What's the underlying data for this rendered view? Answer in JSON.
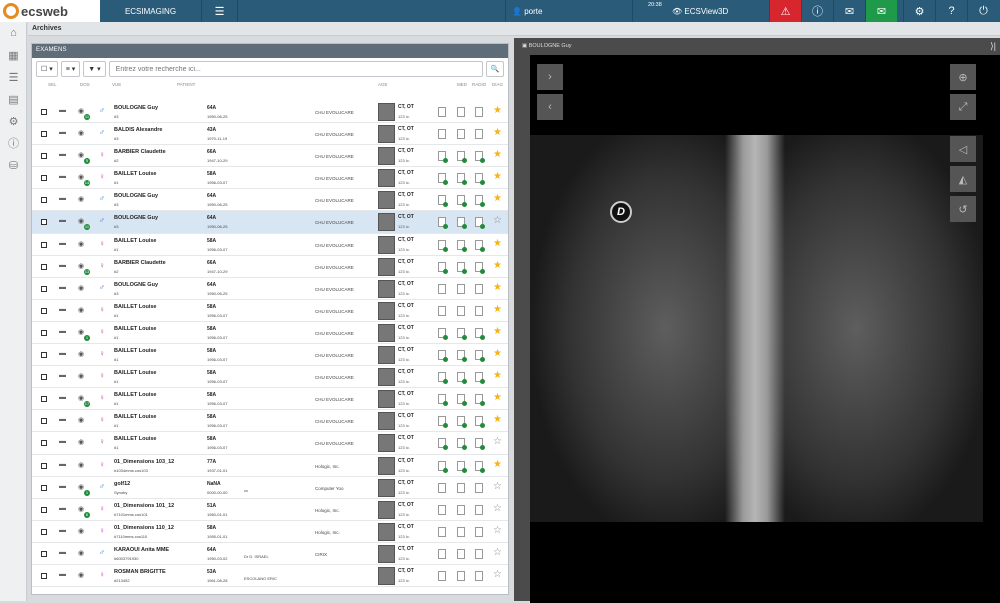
{
  "topbar": {
    "logo_text": "ecsweb",
    "app_name": "ECSIMAGING",
    "menu_icon": "☰",
    "user_name": "porte",
    "time": "20:38",
    "viewer_label": "ECSView3D",
    "alert_color": "#d8262f",
    "mail_color": "#1f9a4a",
    "bar_color": "#2a5b78"
  },
  "breadcrumb": {
    "title": "Archives"
  },
  "panel": {
    "title": "EXAMENS",
    "search_placeholder": "Entrez votre recherche ici...",
    "columns": [
      "SEL",
      "DOS",
      "VUE",
      "PATIENT",
      "AGE",
      "MED",
      "RADIO",
      "DIAG"
    ]
  },
  "rows": [
    {
      "sex": "m",
      "name": "BOULOGNE Guy",
      "sub": "#3",
      "age": "64A",
      "date": "1950-06-25",
      "doc": "",
      "ins": "CHU EVOLUCARE",
      "mod": "CT, OT",
      "imgs": "123 Ic.",
      "badge": "11",
      "star": true,
      "check": false
    },
    {
      "sex": "m",
      "name": "BALDIS Alexandre",
      "sub": "#3",
      "age": "43A",
      "date": "1970-11-19",
      "doc": "",
      "ins": "CHU EVOLUCARE",
      "mod": "CT, OT",
      "imgs": "123 Ic.",
      "badge": "",
      "star": true,
      "check": false
    },
    {
      "sex": "f",
      "name": "BARBIER Claudette",
      "sub": "#2",
      "age": "66A",
      "date": "1947-10-29",
      "doc": "",
      "ins": "CHU EVOLUCARE",
      "mod": "CT, OT",
      "imgs": "123 Ic.",
      "badge": "5",
      "star": true,
      "check": true
    },
    {
      "sex": "f",
      "name": "BAILLET Louise",
      "sub": "#1",
      "age": "58A",
      "date": "1956-03-07",
      "doc": "",
      "ins": "CHU EVOLUCARE",
      "mod": "CT, OT",
      "imgs": "123 Ic.",
      "badge": "14",
      "star": true,
      "check": true
    },
    {
      "sex": "m",
      "name": "BOULOGNE Guy",
      "sub": "#3",
      "age": "64A",
      "date": "1950-06-25",
      "doc": "",
      "ins": "CHU EVOLUCARE",
      "mod": "CT, OT",
      "imgs": "123 Ic.",
      "badge": "",
      "star": true,
      "check": true
    },
    {
      "sex": "m",
      "name": "BOULOGNE Guy",
      "sub": "#3",
      "age": "64A",
      "date": "1950-06-25",
      "doc": "",
      "ins": "CHU EVOLUCARE",
      "mod": "CT, OT",
      "imgs": "123 Ic.",
      "badge": "11",
      "star": false,
      "check": true,
      "sel": true
    },
    {
      "sex": "f",
      "name": "BAILLET Louise",
      "sub": "#1",
      "age": "58A",
      "date": "1956-03-07",
      "doc": "",
      "ins": "CHU EVOLUCARE",
      "mod": "CT, OT",
      "imgs": "123 Ic.",
      "badge": "",
      "star": true,
      "check": true
    },
    {
      "sex": "f",
      "name": "BARBIER Claudette",
      "sub": "#2",
      "age": "66A",
      "date": "1947-10-29",
      "doc": "",
      "ins": "CHU EVOLUCARE",
      "mod": "CT, OT",
      "imgs": "123 Ic.",
      "badge": "13",
      "star": true,
      "check": true
    },
    {
      "sex": "m",
      "name": "BOULOGNE Guy",
      "sub": "#3",
      "age": "64A",
      "date": "1950-06-25",
      "doc": "",
      "ins": "CHU EVOLUCARE",
      "mod": "CT, OT",
      "imgs": "123 Ic.",
      "badge": "",
      "star": true,
      "check": false
    },
    {
      "sex": "f",
      "name": "BAILLET Louise",
      "sub": "#1",
      "age": "58A",
      "date": "1956-03-07",
      "doc": "",
      "ins": "CHU EVOLUCARE",
      "mod": "CT, OT",
      "imgs": "123 Ic.",
      "badge": "",
      "star": true,
      "check": false
    },
    {
      "sex": "f",
      "name": "BAILLET Louise",
      "sub": "#1",
      "age": "58A",
      "date": "1956-03-07",
      "doc": "",
      "ins": "CHU EVOLUCARE",
      "mod": "CT, OT",
      "imgs": "123 Ic.",
      "badge": "1",
      "star": true,
      "check": true
    },
    {
      "sex": "f",
      "name": "BAILLET Louise",
      "sub": "#1",
      "age": "58A",
      "date": "1956-03-07",
      "doc": "",
      "ins": "CHU EVOLUCARE",
      "mod": "CT, OT",
      "imgs": "123 Ic.",
      "badge": "",
      "star": true,
      "check": true
    },
    {
      "sex": "f",
      "name": "BAILLET Louise",
      "sub": "#1",
      "age": "58A",
      "date": "1956-03-07",
      "doc": "",
      "ins": "CHU EVOLUCARE",
      "mod": "CT, OT",
      "imgs": "123 Ic.",
      "badge": "",
      "star": true,
      "check": true
    },
    {
      "sex": "f",
      "name": "BAILLET Louise",
      "sub": "#1",
      "age": "58A",
      "date": "1956-03-07",
      "doc": "",
      "ins": "CHU EVOLUCARE",
      "mod": "CT, OT",
      "imgs": "123 Ic.",
      "badge": "17",
      "star": true,
      "check": true
    },
    {
      "sex": "f",
      "name": "BAILLET Louise",
      "sub": "#1",
      "age": "58A",
      "date": "1956-03-07",
      "doc": "",
      "ins": "CHU EVOLUCARE",
      "mod": "CT, OT",
      "imgs": "123 Ic.",
      "badge": "",
      "star": true,
      "check": true
    },
    {
      "sex": "f",
      "name": "BAILLET Louise",
      "sub": "#1",
      "age": "58A",
      "date": "1956-03-07",
      "doc": "",
      "ins": "CHU EVOLUCARE",
      "mod": "CT, OT",
      "imgs": "123 Ic.",
      "badge": "",
      "star": false,
      "check": true
    },
    {
      "sex": "f",
      "name": "01_Dimensions 103_12",
      "sub": "#1034mms.cos103",
      "age": "77A",
      "date": "1937-01-01",
      "doc": "",
      "ins": "Hologic, Inc.",
      "mod": "CT, OT",
      "imgs": "123 Ic.",
      "badge": "",
      "star": true,
      "check": true
    },
    {
      "sex": "m",
      "name": "golf12",
      "sub": "Synoby",
      "age": "NaNA",
      "date": "0000-00-00",
      "doc": "xx",
      "ins": "Computer Yoo",
      "mod": "CT, OT",
      "imgs": "123 Ic.",
      "badge": "1",
      "star": false,
      "check": false
    },
    {
      "sex": "f",
      "name": "01_Dimensions 101_12",
      "sub": "#7101mms.cos101",
      "age": "51A",
      "date": "1960-01-01",
      "doc": "",
      "ins": "Hologic, Inc.",
      "mod": "CT, OT",
      "imgs": "123 Ic.",
      "badge": "6",
      "star": false,
      "check": false
    },
    {
      "sex": "f",
      "name": "01_Dimensions 110_12",
      "sub": "#7110mms.cos110",
      "age": "58A",
      "date": "1955-01-01",
      "doc": "",
      "ins": "Hologic, Inc.",
      "mod": "CT, OT",
      "imgs": "123 Ic.",
      "badge": "",
      "star": false,
      "check": false
    },
    {
      "sex": "m",
      "name": "KARAOUI Anita MME",
      "sub": "#6003791930",
      "age": "64A",
      "date": "1950-03-02",
      "doc": "Dr D. ISRAEL",
      "ins": "CIRIX",
      "mod": "CT, OT",
      "imgs": "123 Ic.",
      "badge": "",
      "star": false,
      "check": false
    },
    {
      "sex": "f",
      "name": "ROSMAN BRIGITTE",
      "sub": "#213452",
      "age": "53A",
      "date": "1961-08-28",
      "doc": "ESCOLANO ERIC",
      "ins": "",
      "mod": "CT, OT",
      "imgs": "123 Ic.",
      "badge": "",
      "star": false,
      "check": false
    }
  ],
  "viewer": {
    "title": "BOULOGNE Guy",
    "marker": "D"
  }
}
